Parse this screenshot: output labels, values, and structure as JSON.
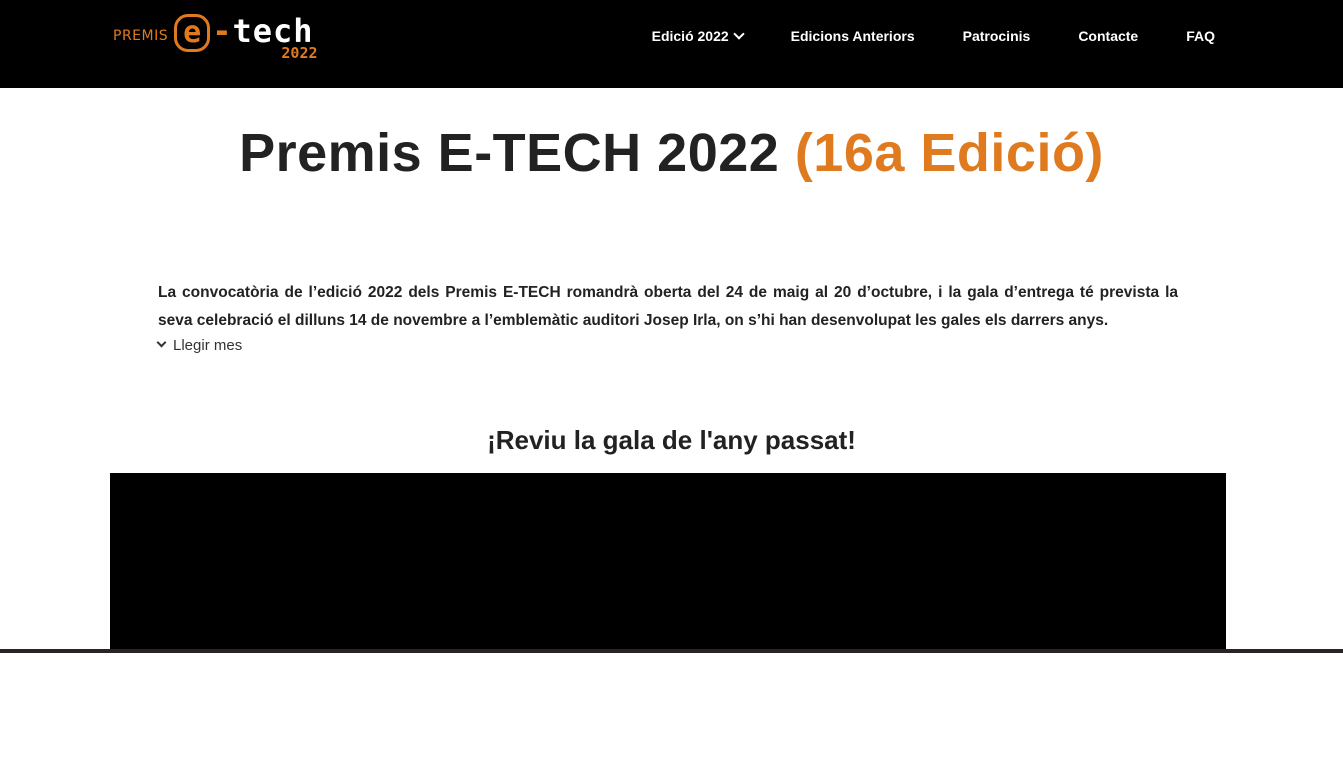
{
  "header": {
    "logo": {
      "premis": "PREMIS",
      "e": "e",
      "dash": "-",
      "tech": "tech",
      "year": "2022"
    },
    "nav": [
      {
        "label": "Edició 2022",
        "has_dropdown": true
      },
      {
        "label": "Edicions Anteriors"
      },
      {
        "label": "Patrocinis"
      },
      {
        "label": "Contacte"
      },
      {
        "label": "FAQ"
      }
    ]
  },
  "main": {
    "title": "Premis E-TECH 2022",
    "title_accent": "(16a Edició)",
    "intro": "La convocatòria de l’edició 2022 dels Premis E-TECH romandrà oberta del 24 de maig al 20 d’octubre, i la gala d’entrega té prevista la seva celebració el dilluns 14 de novembre a l’emblemàtic auditori Josep Irla, on s’hi han desenvolupat les gales els darrers anys.",
    "read_more": "Llegir mes",
    "video_section_title": "¡Reviu la gala de l'any passat!"
  },
  "colors": {
    "accent": "#e07a1f",
    "header_bg": "#000000",
    "text": "#222222"
  },
  "icons": {
    "nav_dropdown": "chevron-down-icon",
    "read_more": "chevron-down-icon"
  }
}
